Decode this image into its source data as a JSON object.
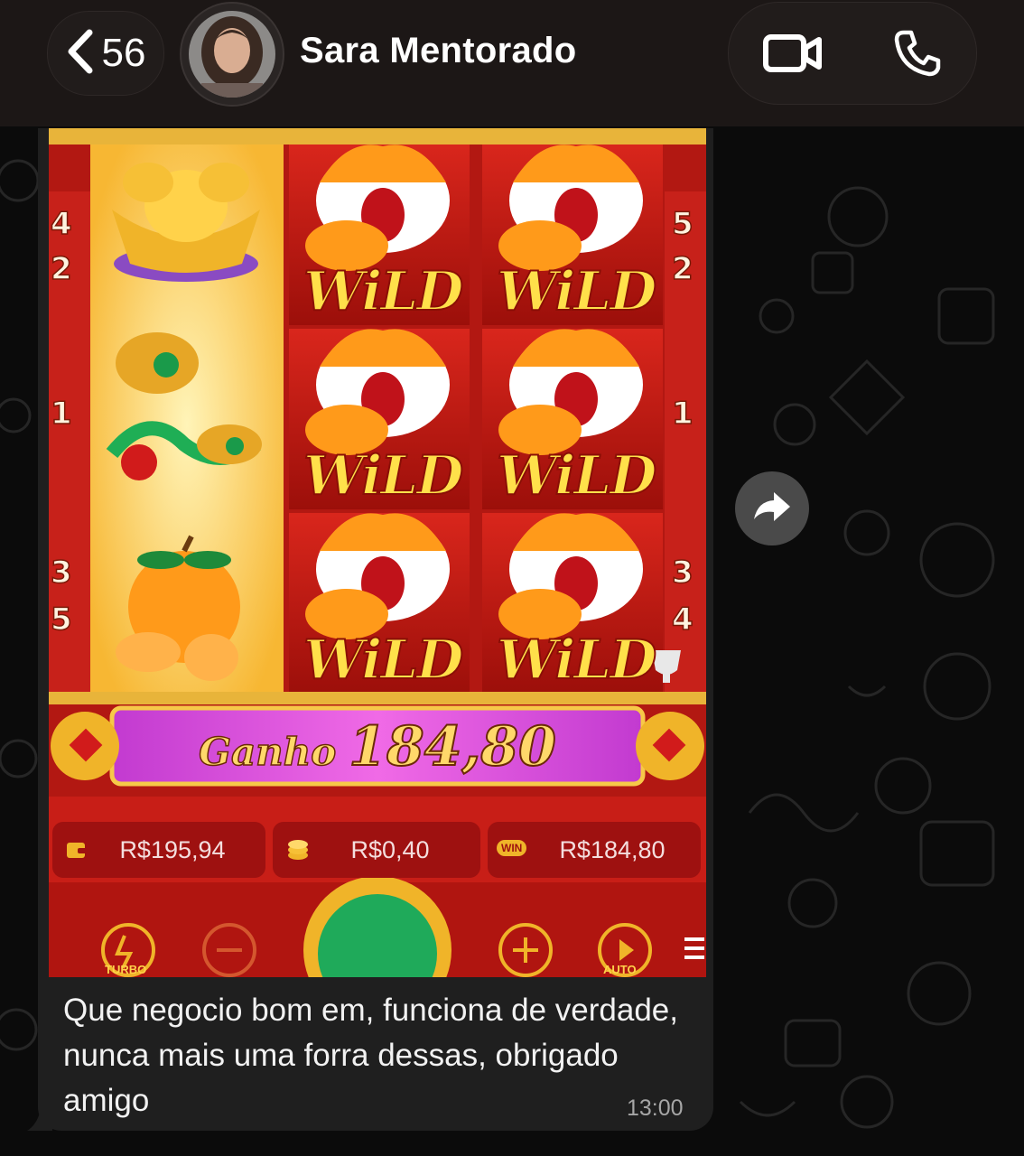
{
  "header": {
    "back_count": "56",
    "contact_name": "Sara Mentorado"
  },
  "game": {
    "reel_numbers_left": [
      "4",
      "2",
      "1",
      "3",
      "5"
    ],
    "reel_numbers_right": [
      "5",
      "2",
      "1",
      "3",
      "4"
    ],
    "wild_label": "WiLD",
    "win_label": "Ganho",
    "win_amount": "184,80",
    "balance": "R$195,94",
    "bet": "R$0,40",
    "win_stat": "R$184,80",
    "win_badge": "WIN",
    "turbo_label": "TURBO",
    "auto_label": "AUTO"
  },
  "message": {
    "text": "Que negocio bom em, funciona de verdade, nunca mais uma forra dessas, obrigado amigo",
    "time": "13:00"
  },
  "colors": {
    "header_bg": "#1c1716",
    "bubble_bg": "#1f1f1f",
    "game_red": "#b21812",
    "gold": "#ffd86a",
    "win_bar": "#d946d6"
  },
  "icons": {
    "back": "chevron-left-icon",
    "video": "video-camera-icon",
    "phone": "phone-icon",
    "forward": "forward-arrow-icon"
  }
}
